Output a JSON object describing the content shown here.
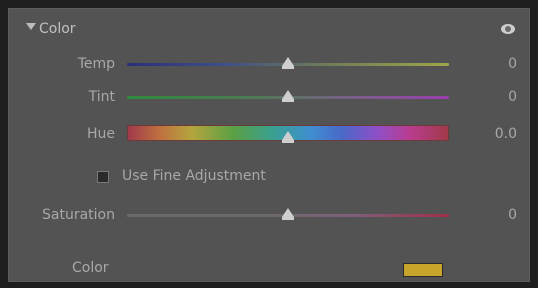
{
  "panel": {
    "title": "Color",
    "eye_icon": "eye-icon",
    "collapse_icon": "triangle-down-icon"
  },
  "sliders": {
    "temp": {
      "label": "Temp",
      "value": "0",
      "position": 0.5
    },
    "tint": {
      "label": "Tint",
      "value": "0",
      "position": 0.5
    },
    "hue": {
      "label": "Hue",
      "value": "0.0",
      "position": 0.5
    },
    "saturation": {
      "label": "Saturation",
      "value": "0",
      "position": 0.5
    }
  },
  "fine_adjustment": {
    "label": "Use Fine Adjustment",
    "checked": false
  },
  "color": {
    "label": "Color",
    "swatch_color": "#c9a42a"
  }
}
